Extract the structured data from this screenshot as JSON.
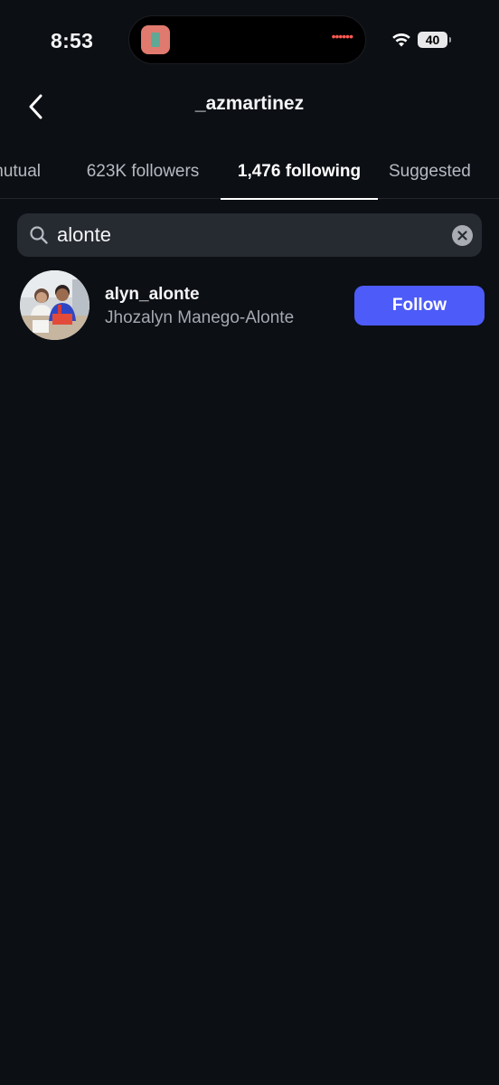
{
  "status_bar": {
    "time": "8:53",
    "battery": "40",
    "dots": "••••••",
    "icons": [
      "app-icon",
      "wifi-icon",
      "battery-icon"
    ]
  },
  "header": {
    "back_icon": "chevron-left-icon",
    "title": "_azmartinez"
  },
  "tabs": [
    {
      "label": "mutual",
      "active": false
    },
    {
      "label": "623K followers",
      "active": false
    },
    {
      "label": "1,476 following",
      "active": true
    },
    {
      "label": "Suggested",
      "active": false
    }
  ],
  "search": {
    "value": "alonte",
    "icon": "search-icon",
    "clear_icon": "clear-icon"
  },
  "results": [
    {
      "username": "alyn_alonte",
      "full_name": "Jhozalyn Manego-Alonte",
      "button_label": "Follow",
      "avatar": "avatar-photo"
    }
  ],
  "colors": {
    "background": "#0c0f14",
    "search_bg": "#262a31",
    "accent": "#4d5bf9",
    "secondary_text": "#a5a8b0"
  }
}
